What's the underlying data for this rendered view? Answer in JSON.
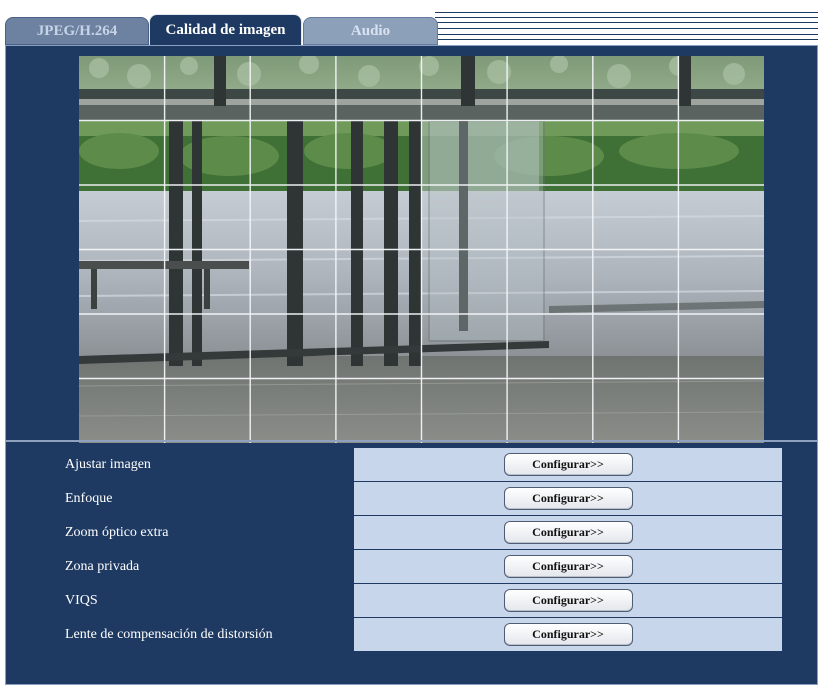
{
  "tabs": [
    {
      "label": "JPEG/H.264",
      "state": "inactive"
    },
    {
      "label": "Calidad de imagen",
      "state": "active"
    },
    {
      "label": "Audio",
      "state": "inactive"
    }
  ],
  "settings": {
    "rows": [
      {
        "label": "Ajustar imagen",
        "button": "Configurar>>"
      },
      {
        "label": "Enfoque",
        "button": "Configurar>>"
      },
      {
        "label": "Zoom óptico extra",
        "button": "Configurar>>"
      },
      {
        "label": "Zona privada",
        "button": "Configurar>>"
      },
      {
        "label": "VIQS",
        "button": "Configurar>>"
      },
      {
        "label": "Lente de compensación de distorsión",
        "button": "Configurar>>"
      }
    ]
  },
  "colors": {
    "panel_bg": "#1e3a62",
    "row_value_bg": "#c8d6ec",
    "tab_inactive": "#6d82a1"
  }
}
